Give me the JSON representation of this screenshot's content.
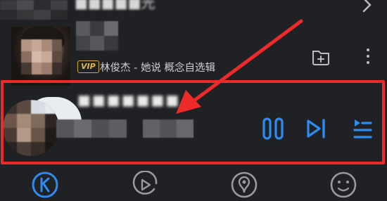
{
  "top_song": {
    "title": "■■■■■光",
    "vip_badge": "VIP",
    "artist_album": "林俊杰 - 她说 概念自选辑"
  },
  "player": {
    "title": "■■■■■■■",
    "subtitle": ""
  },
  "icons": {
    "chevron": "chevron-right-icon",
    "add_to": "add-to-folder-icon",
    "more": "more-vertical-icon",
    "pause": "pause-icon",
    "next": "next-track-icon",
    "playlist": "playlist-icon",
    "nav_home": "kugou-home-icon",
    "nav_video": "video-play-icon",
    "nav_live": "live-listen-icon",
    "nav_me": "smiley-profile-icon"
  },
  "colors": {
    "background": "#202124",
    "accent_blue": "#2e8bf0",
    "annotation_red": "#ec2a29",
    "vip_gold": "#d1a93f"
  }
}
